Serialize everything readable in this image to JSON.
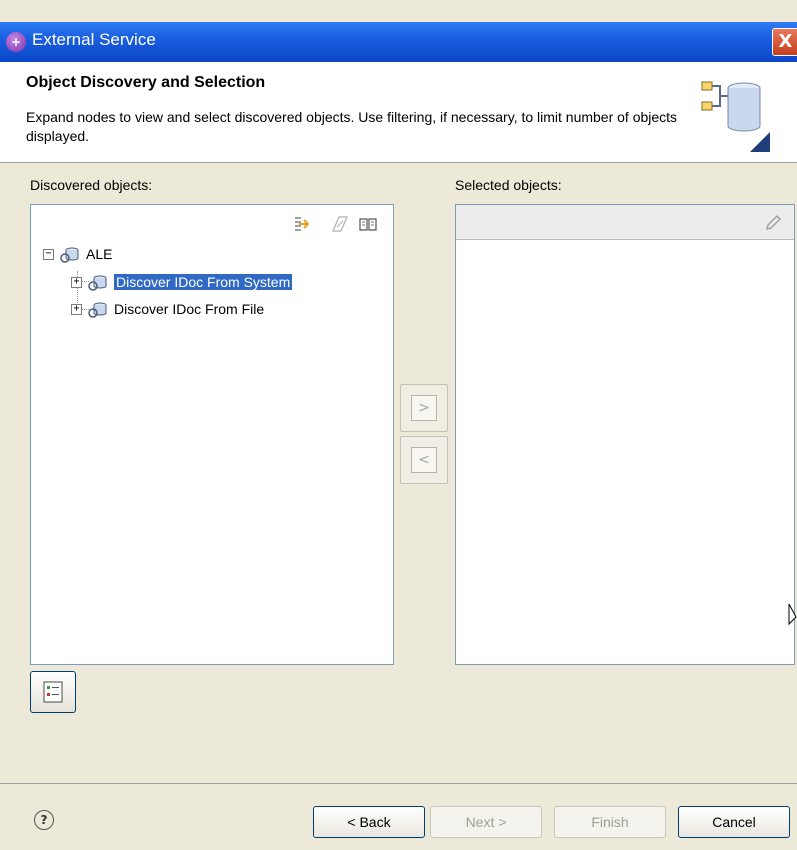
{
  "window": {
    "title": "External Service",
    "close_label": "X",
    "app_icon_label": "+"
  },
  "header": {
    "title": "Object Discovery and Selection",
    "description": "Expand nodes to view and select discovered objects.  Use filtering, if necessary, to limit number of objects displayed."
  },
  "discovered": {
    "label": "Discovered objects:",
    "toolbar_icons": [
      "filter-arrow-icon",
      "edit-query-icon",
      "book-icon"
    ],
    "tree": {
      "root": {
        "label": "ALE",
        "toggle": "−"
      },
      "children": [
        {
          "label": "Discover IDoc From System",
          "toggle": "+",
          "selected": true
        },
        {
          "label": "Discover IDoc From File",
          "toggle": "+",
          "selected": false
        }
      ]
    }
  },
  "selected": {
    "label": "Selected objects:",
    "toolbar_icons": [
      "pencil-icon"
    ]
  },
  "transfer": {
    "add_label": ">",
    "remove_label": "<"
  },
  "footer": {
    "help_label": "?",
    "back_label": "< Back",
    "next_label": "Next >",
    "finish_label": "Finish",
    "cancel_label": "Cancel"
  }
}
